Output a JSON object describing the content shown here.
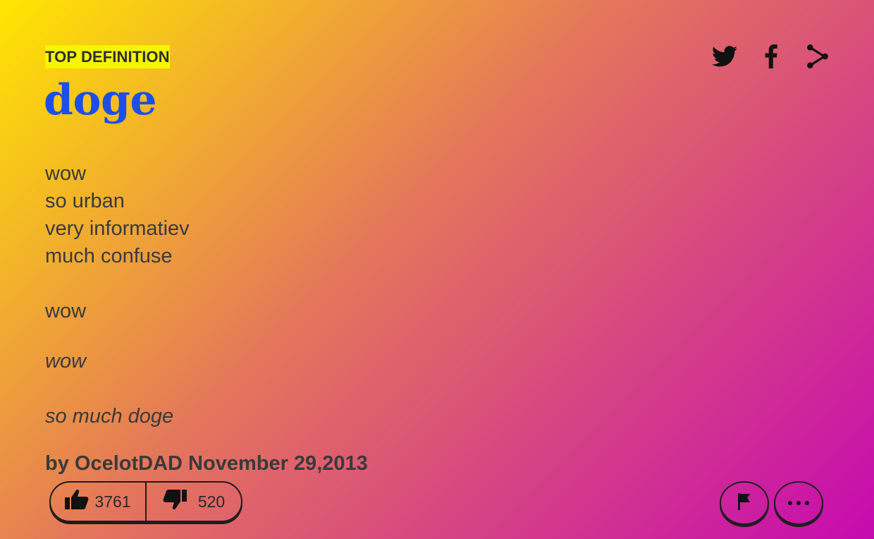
{
  "theme": {
    "gradient_start": "#ffe600",
    "gradient_mid": "#e3735e",
    "gradient_end": "#c60ab0",
    "ribbon_bg": "#f5f500",
    "word_color": "#1c4fe6",
    "text_color": "#3a3a3a"
  },
  "definition": {
    "ribbon_label": "TOP DEFINITION",
    "word": "doge",
    "meaning_lines": [
      "wow",
      "so urban",
      "very informatiev",
      "much confuse",
      "",
      "wow"
    ],
    "example_lines": [
      "wow",
      "",
      "so much doge"
    ],
    "by_label": "by",
    "author": "OcelotDAD",
    "date": "November 29,2013"
  },
  "share": {
    "icons": [
      "twitter-icon",
      "facebook-icon",
      "share-icon"
    ]
  },
  "votes": {
    "up_count": "3761",
    "down_count": "520",
    "up_icon": "thumbs-up-icon",
    "down_icon": "thumbs-down-icon"
  },
  "actions": {
    "flag_icon": "flag-icon",
    "more_icon": "more-icon"
  }
}
